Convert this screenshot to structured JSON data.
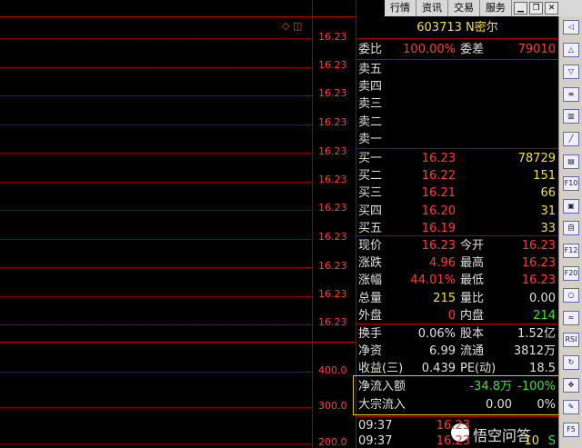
{
  "chart": {
    "price_labels": [
      "16.23",
      "16.23",
      "16.23",
      "16.23",
      "16.23",
      "16.23",
      "16.23",
      "16.23",
      "16.23",
      "16.23",
      "16.23",
      "16.23"
    ],
    "volume_labels": [
      "400.0",
      "300.0",
      "200.0"
    ],
    "top_icons": "◇ ◫"
  },
  "topbar": {
    "items": [
      "行情",
      "资讯",
      "交易",
      "服务"
    ]
  },
  "quote": {
    "code_name": "603713 N密尔",
    "weibi_label": "委比",
    "weibi_value": "100.00%",
    "weicha_label": "委差",
    "weicha_value": "79010",
    "sell": [
      {
        "label": "卖五",
        "price": "",
        "vol": ""
      },
      {
        "label": "卖四",
        "price": "",
        "vol": ""
      },
      {
        "label": "卖三",
        "price": "",
        "vol": ""
      },
      {
        "label": "卖二",
        "price": "",
        "vol": ""
      },
      {
        "label": "卖一",
        "price": "",
        "vol": ""
      }
    ],
    "buy": [
      {
        "label": "买一",
        "price": "16.23",
        "vol": "78729"
      },
      {
        "label": "买二",
        "price": "16.22",
        "vol": "151"
      },
      {
        "label": "买三",
        "price": "16.21",
        "vol": "66"
      },
      {
        "label": "买四",
        "price": "16.20",
        "vol": "31"
      },
      {
        "label": "买五",
        "price": "16.19",
        "vol": "33"
      }
    ],
    "stats": [
      {
        "l1": "现价",
        "v1": "16.23",
        "l2": "今开",
        "v2": "16.23",
        "c2": "red"
      },
      {
        "l1": "涨跌",
        "v1": "4.96",
        "l2": "最高",
        "v2": "16.23",
        "c2": "red"
      },
      {
        "l1": "涨幅",
        "v1": "44.01%",
        "l2": "最低",
        "v2": "16.23",
        "c2": "red"
      },
      {
        "l1": "总量",
        "v1": "215",
        "l2": "量比",
        "v2": "0.00",
        "c2": "white",
        "c1": "yellow"
      },
      {
        "l1": "外盘",
        "v1": "0",
        "l2": "内盘",
        "v2": "214",
        "c2": "green"
      }
    ],
    "stats2": [
      {
        "l1": "换手",
        "v1": "0.06%",
        "l2": "股本",
        "v2": "1.52亿"
      },
      {
        "l1": "净资",
        "v1": "6.99",
        "l2": "流通",
        "v2": "3812万"
      },
      {
        "l1": "收益(三)",
        "v1": "0.439",
        "l2": "PE(动)",
        "v2": "18.5"
      }
    ],
    "netflow_label": "净流入额",
    "netflow_value": "-34.8万",
    "netflow_pct": "-100%",
    "block_label": "大宗流入",
    "block_value": "0.00",
    "block_pct": "0%",
    "ticks": [
      {
        "time": "09:37",
        "price": "16.23",
        "vol": "",
        "flag": ""
      },
      {
        "time": "09:37",
        "price": "16.23",
        "vol": "10",
        "flag": "S"
      }
    ]
  },
  "toolbar": {
    "icons": [
      "arrow-left-icon",
      "arrow-up-icon",
      "arrow-down-icon",
      "list-icon",
      "bar-chart-icon",
      "line-chart-icon",
      "candle-icon",
      "f10-icon",
      "f10b-icon",
      "self-select-icon",
      "f12-icon",
      "f20-icon",
      "ring-icon",
      "wave-icon",
      "rsi-icon",
      "rotate-icon",
      "move-icon",
      "pen-icon",
      "f5-icon"
    ],
    "labels": [
      "◁",
      "△",
      "▽",
      "≡",
      "▥",
      "╱",
      "▤",
      "F10",
      "▣",
      "自",
      "F12",
      "F20",
      "○",
      "≈",
      "RSI",
      "↻",
      "✥",
      "✎",
      "F5"
    ]
  },
  "watermark": "悟空问答"
}
